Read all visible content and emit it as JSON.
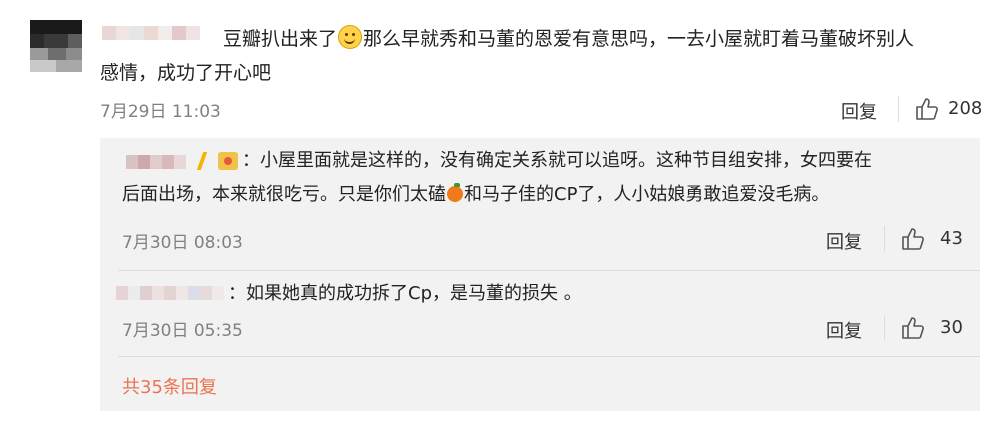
{
  "comment": {
    "text_line1": "豆瓣扒出来了",
    "text_line1b": "那么早就秀和马董的恩爱有意思吗，一去小屋就盯着马董破坏别人",
    "text_line2": "感情，成功了开心吧",
    "timestamp": "7月29日 11:03",
    "reply_label": "回复",
    "likes": "208",
    "emoji": "smile-emoji"
  },
  "replies": [
    {
      "colon": "：",
      "line1": "小屋里面就是这样的，没有确定关系就可以追呀。这种节目组安排，女四要在",
      "line2a": "后面出场，本来就很吃亏。只是你们太磕",
      "line2b": "和马子佳的CP了，人小姑娘勇敢追爱没毛病。",
      "timestamp": "7月30日 08:03",
      "reply_label": "回复",
      "likes": "43"
    },
    {
      "colon": "：",
      "line1": "如果她真的成功拆了Cp，是马董的损失 。",
      "timestamp": "7月30日 05:35",
      "reply_label": "回复",
      "likes": "30"
    }
  ],
  "more_replies": "共35条回复",
  "colors": {
    "link": "#eb7350",
    "reply_bg": "#f2f2f2",
    "meta": "#808080"
  }
}
